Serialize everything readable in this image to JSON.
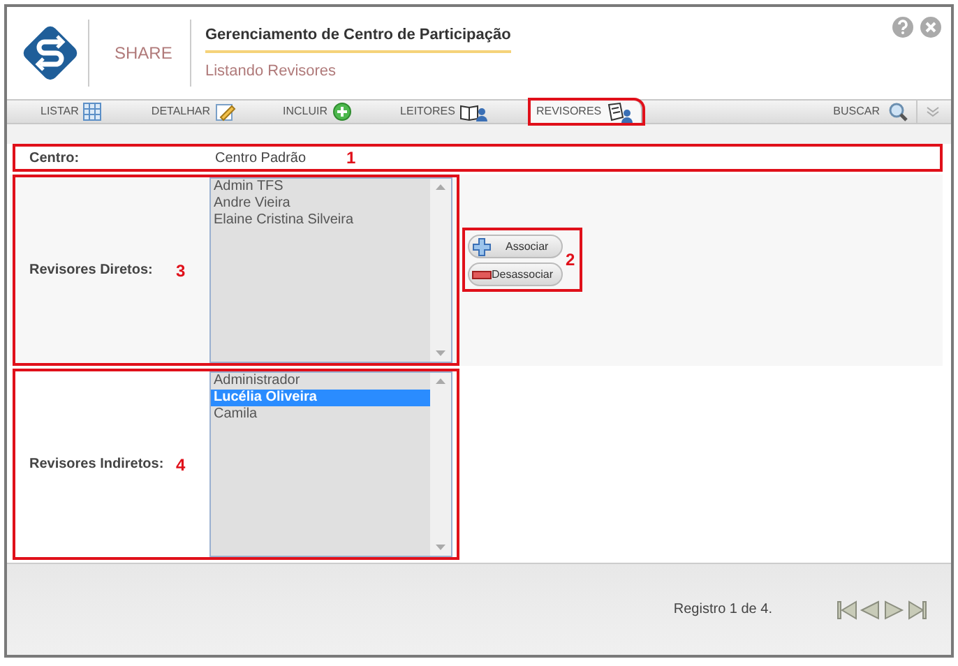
{
  "header": {
    "brand": "SHARE",
    "title": "Gerenciamento de Centro de Participação",
    "subtitle": "Listando Revisores"
  },
  "tabs": [
    {
      "label": "LISTAR",
      "kind": "table",
      "selected": false,
      "highlighted": false
    },
    {
      "label": "DETALHAR",
      "kind": "edit",
      "selected": false,
      "highlighted": false
    },
    {
      "label": "INCLUIR",
      "kind": "add",
      "selected": false,
      "highlighted": false
    },
    {
      "label": "LEITORES",
      "kind": "readers",
      "selected": false,
      "highlighted": false
    },
    {
      "label": "REVISORES",
      "kind": "reviewers",
      "selected": true,
      "highlighted": true
    }
  ],
  "search_label": "BUSCAR",
  "centro": {
    "label": "Centro:",
    "value": "Centro Padrão",
    "callout": "1"
  },
  "direct": {
    "label": "Revisores Diretos:",
    "callout": "3",
    "items": [
      {
        "name": "Admin TFS",
        "selected": false
      },
      {
        "name": "Andre Vieira",
        "selected": false
      },
      {
        "name": "Elaine Cristina Silveira",
        "selected": false
      }
    ]
  },
  "actions": {
    "callout": "2",
    "buttons": [
      {
        "label": "Associar",
        "kind": "add"
      },
      {
        "label": "Desassociar",
        "kind": "remove"
      }
    ]
  },
  "indirect": {
    "label": "Revisores Indiretos:",
    "callout": "4",
    "items": [
      {
        "name": "Administrador",
        "selected": false
      },
      {
        "name": "Lucélia Oliveira",
        "selected": true
      },
      {
        "name": "Camila",
        "selected": false
      }
    ]
  },
  "footer": {
    "record": "Registro 1 de 4."
  }
}
